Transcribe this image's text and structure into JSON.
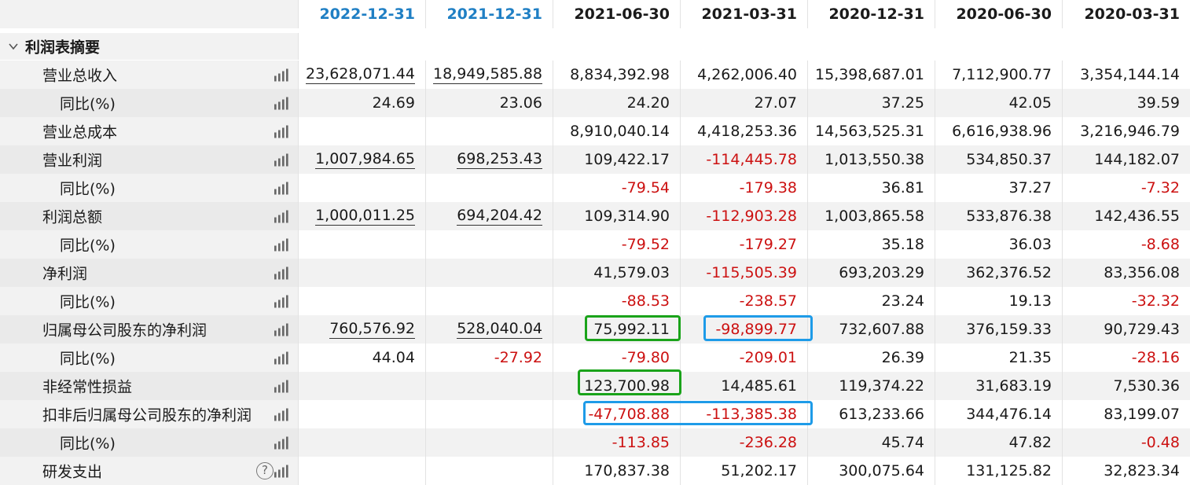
{
  "header": {
    "dates": [
      "2022-12-31",
      "2021-12-31",
      "2021-06-30",
      "2021-03-31",
      "2020-12-31",
      "2020-06-30",
      "2020-03-31"
    ],
    "highlighted_dates": [
      0,
      1
    ],
    "accent_color": "#1f7fc4"
  },
  "section": {
    "title": "利润表摘要",
    "expand_icon": "chevron-down-icon"
  },
  "rows": [
    {
      "label": "营业总收入",
      "indent": 1,
      "values": [
        "23,628,071.44",
        "18,949,585.88",
        "8,834,392.98",
        "4,262,006.40",
        "15,398,687.01",
        "7,112,900.77",
        "3,354,144.14"
      ]
    },
    {
      "label": "同比(%)",
      "indent": 2,
      "values": [
        "24.69",
        "23.06",
        "24.20",
        "27.07",
        "37.25",
        "42.05",
        "39.59"
      ]
    },
    {
      "label": "营业总成本",
      "indent": 1,
      "values": [
        "",
        "",
        "8,910,040.14",
        "4,418,253.36",
        "14,563,525.31",
        "6,616,938.96",
        "3,216,946.79"
      ]
    },
    {
      "label": "营业利润",
      "indent": 1,
      "values": [
        "1,007,984.65",
        "698,253.43",
        "109,422.17",
        "-114,445.78",
        "1,013,550.38",
        "534,850.37",
        "144,182.07"
      ]
    },
    {
      "label": "同比(%)",
      "indent": 2,
      "values": [
        "",
        "",
        "-79.54",
        "-179.38",
        "36.81",
        "37.27",
        "-7.32"
      ]
    },
    {
      "label": "利润总额",
      "indent": 1,
      "values": [
        "1,000,011.25",
        "694,204.42",
        "109,314.90",
        "-112,903.28",
        "1,003,865.58",
        "533,876.38",
        "142,436.55"
      ]
    },
    {
      "label": "同比(%)",
      "indent": 2,
      "values": [
        "",
        "",
        "-79.52",
        "-179.27",
        "35.18",
        "36.03",
        "-8.68"
      ]
    },
    {
      "label": "净利润",
      "indent": 1,
      "values": [
        "",
        "",
        "41,579.03",
        "-115,505.39",
        "693,203.29",
        "362,376.52",
        "83,356.08"
      ]
    },
    {
      "label": "同比(%)",
      "indent": 2,
      "values": [
        "",
        "",
        "-88.53",
        "-238.57",
        "23.24",
        "19.13",
        "-32.32"
      ]
    },
    {
      "label": "归属母公司股东的净利润",
      "indent": 1,
      "values": [
        "760,576.92",
        "528,040.04",
        "75,992.11",
        "-98,899.77",
        "732,607.88",
        "376,159.33",
        "90,729.43"
      ]
    },
    {
      "label": "同比(%)",
      "indent": 2,
      "values": [
        "44.04",
        "-27.92",
        "-79.80",
        "-209.01",
        "26.39",
        "21.35",
        "-28.16"
      ]
    },
    {
      "label": "非经常性损益",
      "indent": 1,
      "values": [
        "",
        "",
        "123,700.98",
        "14,485.61",
        "119,374.22",
        "31,683.19",
        "7,530.36"
      ]
    },
    {
      "label": "扣非后归属母公司股东的净利润",
      "indent": 1,
      "values": [
        "",
        "",
        "-47,708.88",
        "-113,385.38",
        "613,233.66",
        "344,476.14",
        "83,199.07"
      ]
    },
    {
      "label": "同比(%)",
      "indent": 2,
      "values": [
        "",
        "",
        "-113.85",
        "-236.28",
        "45.74",
        "47.82",
        "-0.48"
      ]
    },
    {
      "label": "研发支出",
      "indent": 1,
      "help": "?",
      "values": [
        "",
        "",
        "170,837.38",
        "51,202.17",
        "300,075.64",
        "131,125.82",
        "32,823.34"
      ]
    }
  ],
  "icons": {
    "row_chart": "bar-chart-icon",
    "help": "help-icon"
  },
  "colors": {
    "negative": "#cc1111",
    "highlight_green": "#1aa31a",
    "highlight_blue": "#1e9be8"
  }
}
